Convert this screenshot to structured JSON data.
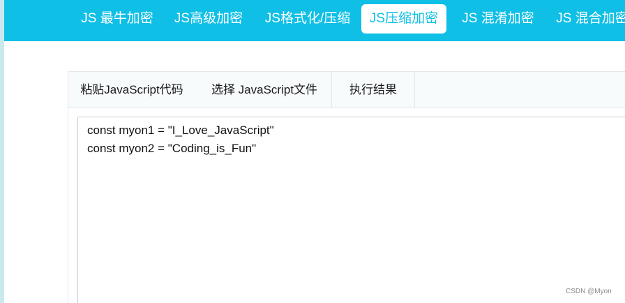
{
  "topnav": {
    "tabs": [
      {
        "label": "JS 最牛加密"
      },
      {
        "label": "JS高级加密"
      },
      {
        "label": "JS格式化/压缩"
      },
      {
        "label": "JS压缩加密"
      },
      {
        "label": "JS 混淆加密"
      },
      {
        "label": "JS 混合加密"
      }
    ],
    "active_index": 3
  },
  "panel": {
    "tabs": [
      {
        "label": "粘贴JavaScript代码"
      },
      {
        "label": "选择 JavaScript文件"
      },
      {
        "label": "执行结果"
      }
    ],
    "editor": {
      "lines": [
        "const myon1 = \"I_Love_JavaScript\"",
        "const myon2 = \"Coding_is_Fun\""
      ]
    }
  },
  "watermark": "CSDN @Myon⁠",
  "colors": {
    "nav_background": "#0fbfe6",
    "active_tab_text": "#0fbfe6",
    "panel_tab_background": "#f7fbfc"
  }
}
